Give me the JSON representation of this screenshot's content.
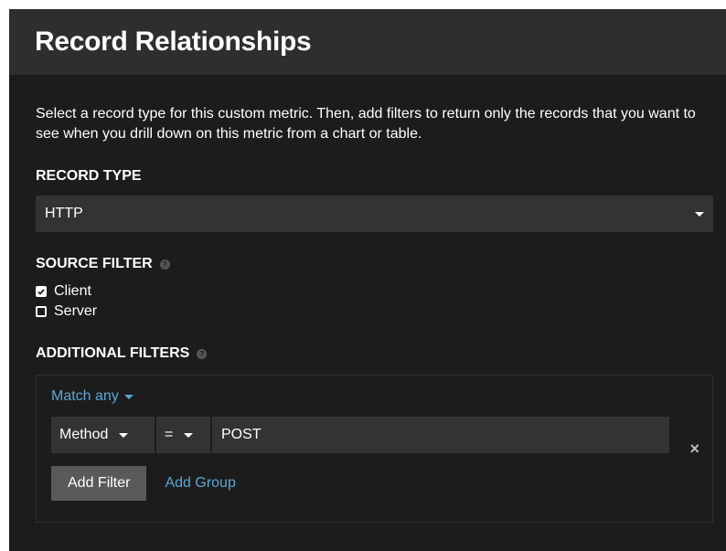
{
  "header": {
    "title": "Record Relationships"
  },
  "description": "Select a record type for this custom metric. Then, add filters to return only the records that you want to see when you drill down on this metric from a chart or table.",
  "record_type": {
    "label": "RECORD TYPE",
    "selected": "HTTP"
  },
  "source_filter": {
    "label": "SOURCE FILTER",
    "options": [
      {
        "label": "Client",
        "checked": true
      },
      {
        "label": "Server",
        "checked": false
      }
    ]
  },
  "additional_filters": {
    "label": "ADDITIONAL FILTERS",
    "match": "Match any",
    "filter": {
      "field": "Method",
      "operator": "=",
      "value": "POST"
    },
    "remove_icon": "×",
    "add_filter_label": "Add Filter",
    "add_group_label": "Add Group"
  },
  "colors": {
    "panel_bg": "#1c1c1c",
    "header_bg": "#2e2e2e",
    "control_bg": "#333333",
    "link": "#5aa8d6"
  }
}
